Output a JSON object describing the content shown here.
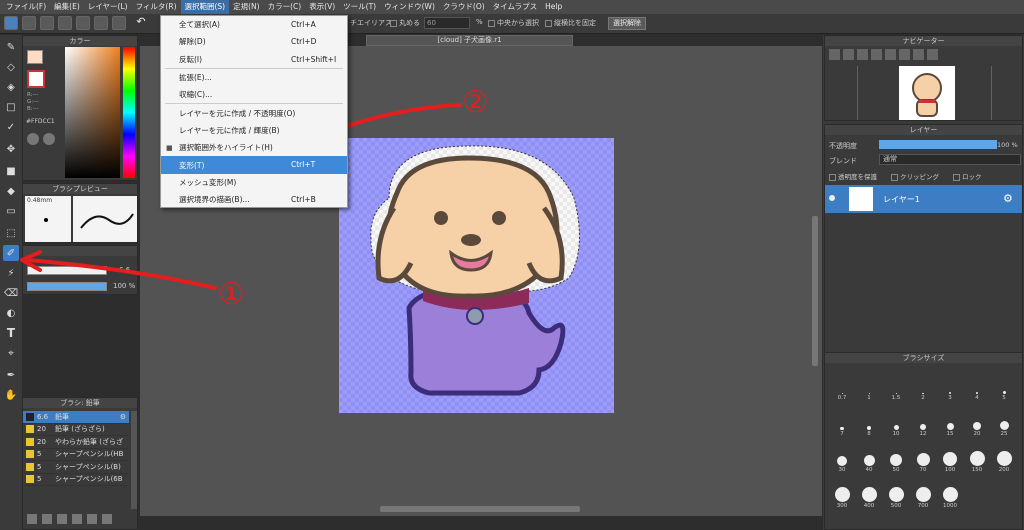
{
  "menubar": {
    "items": [
      "ファイル(F)",
      "編集(E)",
      "レイヤー(L)",
      "フィルタ(R)",
      "選択範囲(S)",
      "定規(N)",
      "カラー(C)",
      "表示(V)",
      "ツール(T)",
      "ウィンドウ(W)",
      "クラウド(O)",
      "タイムラプス",
      "Help"
    ],
    "active_index": 4
  },
  "toolbar": {
    "antialias_label": "チエイリアス",
    "round_label": "丸める",
    "round_value": "60",
    "percent": "%",
    "center_select": "中央から選択",
    "keep_ratio": "縦横比を固定",
    "deselect": "選択解除"
  },
  "doc_tab": "[cloud] 子犬画像.r1",
  "dropdown": {
    "items": [
      {
        "label": "全て選択(A)",
        "shortcut": "Ctrl+A"
      },
      {
        "label": "解除(D)",
        "shortcut": "Ctrl+D"
      },
      {
        "label": "反転(I)",
        "shortcut": "Ctrl+Shift+I"
      },
      {
        "label": "拡張(E)...",
        "shortcut": ""
      },
      {
        "label": "収縮(C)...",
        "shortcut": ""
      },
      {
        "label": "レイヤーを元に作成 / 不透明度(O)",
        "shortcut": ""
      },
      {
        "label": "レイヤーを元に作成 / 輝度(B)",
        "shortcut": ""
      },
      {
        "label": "選択範囲外をハイライト(H)",
        "shortcut": "",
        "mark": "■"
      },
      {
        "label": "変形(T)",
        "shortcut": "Ctrl+T",
        "highlight": true
      },
      {
        "label": "メッシュ変形(M)",
        "shortcut": ""
      },
      {
        "label": "選択境界の描画(B)...",
        "shortcut": "Ctrl+B"
      }
    ]
  },
  "color_panel": {
    "title": "カラー",
    "r": "R:---",
    "g": "G:---",
    "b": "B:---",
    "hex": "#FFDCC1"
  },
  "brush_preview": {
    "title": "ブラシプレビュー",
    "size": "0.48mm"
  },
  "brush_control": {
    "size_value": "6.6",
    "opacity_value": "100 %"
  },
  "brush_list": {
    "title": "ブラシ: 鉛筆",
    "items": [
      {
        "num": "6.6",
        "name": "鉛筆",
        "selected": true
      },
      {
        "num": "20",
        "name": "鉛筆 (ざらざら)"
      },
      {
        "num": "20",
        "name": "やわらか鉛筆 (ざらざ"
      },
      {
        "num": "5",
        "name": "シャープペンシル(HB"
      },
      {
        "num": "5",
        "name": "シャープペンシル(B)"
      },
      {
        "num": "5",
        "name": "シャープペンシル(6B"
      }
    ]
  },
  "navigator": {
    "title": "ナビゲーター"
  },
  "layer_panel": {
    "title": "レイヤー",
    "opacity_label": "不透明度",
    "opacity_value": "100 %",
    "blend_label": "ブレンド",
    "blend_value": "通常",
    "protect_alpha": "透明度を保護",
    "clipping": "クリッピング",
    "lock": "ロック",
    "layer_name": "レイヤー1"
  },
  "brush_size": {
    "title": "ブラシサイズ",
    "sizes": [
      "0.7",
      "1",
      "1.5",
      "2",
      "3",
      "4",
      "5",
      "7",
      "8",
      "10",
      "12",
      "15",
      "20",
      "25",
      "30",
      "40",
      "50",
      "70",
      "100",
      "150",
      "200",
      "300",
      "400",
      "500",
      "700",
      "1000"
    ]
  },
  "annotations": {
    "one": "①",
    "two": "②"
  },
  "colors": {
    "accent": "#3c7dc4",
    "bg_fill": "#8c8cf5",
    "fur": "#f6d1a8",
    "outline": "#5b4a3c",
    "shirt": "#9b7fd8",
    "collar": "#8c2a5a",
    "arrow": "#e21e1e"
  }
}
